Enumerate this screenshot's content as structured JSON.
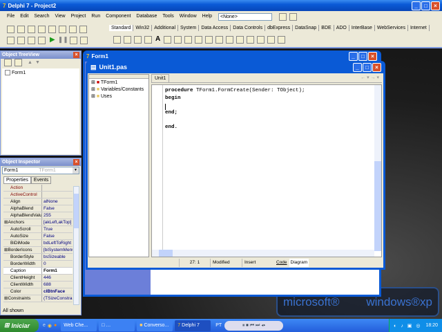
{
  "app": {
    "title": "Delphi 7 - Project2"
  },
  "menu": [
    "File",
    "Edit",
    "Search",
    "View",
    "Project",
    "Run",
    "Component",
    "Database",
    "Tools",
    "Window",
    "Help"
  ],
  "desktop_combo": "<None>",
  "palette_tabs": [
    "Standard",
    "Win32",
    "Additional",
    "System",
    "Data Access",
    "Data Controls",
    "dbExpress",
    "DataSnap",
    "BDE",
    "ADO",
    "InterBase",
    "WebServices",
    "Internet"
  ],
  "treeview": {
    "title": "Object TreeView",
    "item": "Form1"
  },
  "inspector": {
    "title": "Object Inspector",
    "object": "Form1",
    "type": "TForm1",
    "tabs": [
      "Properties",
      "Events"
    ],
    "rows": [
      {
        "k": "Action",
        "v": ""
      },
      {
        "k": "ActiveControl",
        "v": ""
      },
      {
        "k": "Align",
        "v": "alNone"
      },
      {
        "k": "AlphaBlend",
        "v": "False"
      },
      {
        "k": "AlphaBlendValu",
        "v": "255"
      },
      {
        "k": "Anchors",
        "v": "[akLeft,akTop]"
      },
      {
        "k": "AutoScroll",
        "v": "True"
      },
      {
        "k": "AutoSize",
        "v": "False"
      },
      {
        "k": "BiDiMode",
        "v": "bdLeftToRight"
      },
      {
        "k": "BorderIcons",
        "v": "[biSystemMenu,"
      },
      {
        "k": "BorderStyle",
        "v": "bsSizeable"
      },
      {
        "k": "BorderWidth",
        "v": "0"
      },
      {
        "k": "Caption",
        "v": "Form1"
      },
      {
        "k": "ClientHeight",
        "v": "446"
      },
      {
        "k": "ClientWidth",
        "v": "688"
      },
      {
        "k": "Color",
        "v": "clBtnFace"
      },
      {
        "k": "Constraints",
        "v": "(TSizeConstrain"
      }
    ],
    "status": "All shown"
  },
  "form": {
    "title": "Form1"
  },
  "editor": {
    "title": "Unit1.pas",
    "tab": "Unit1",
    "explorer": [
      "TForm1",
      "Variables/Constants",
      "Uses"
    ],
    "code": [
      "procedure TForm1.FormCreate(Sender: TObject);",
      "begin",
      "",
      "end;",
      "",
      "end."
    ],
    "status": {
      "pos": "27:  1",
      "modified": "Modified",
      "mode": "Insert"
    },
    "bottom_tabs": [
      "Code",
      "Diagram"
    ]
  },
  "wallpaper": {
    "left": "microsoft®",
    "right": "windows®xp"
  },
  "taskbar": {
    "start": "Iniciar",
    "tasks": [
      "Web Che...",
      "",
      "Converso...",
      "Delphi 7"
    ],
    "lang": "PT",
    "clock": "18:20"
  }
}
